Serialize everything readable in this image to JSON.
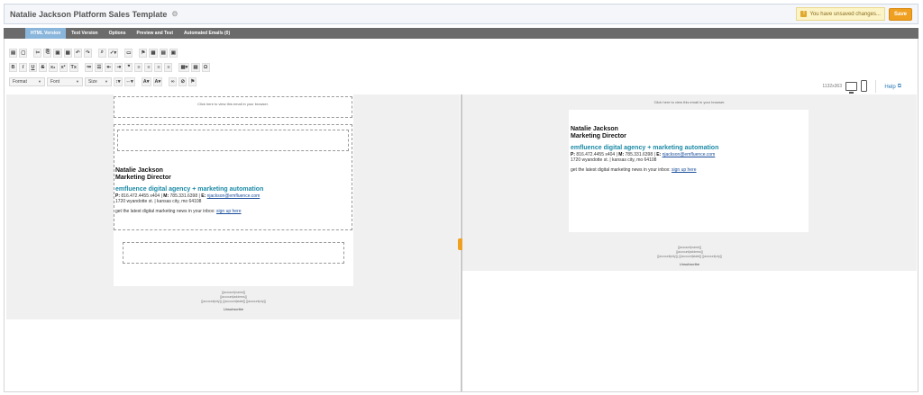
{
  "header": {
    "title": "Natalie Jackson Platform Sales Template",
    "unsaved_text": "You have unsaved changes...",
    "save_label": "Save"
  },
  "tabs": [
    {
      "label": "HTML Version",
      "active": true
    },
    {
      "label": "Text Version",
      "active": false
    },
    {
      "label": "Options",
      "active": false
    },
    {
      "label": "Preview and Test",
      "active": false
    },
    {
      "label": "Automated Emails (0)",
      "active": false
    }
  ],
  "toolbar": {
    "row1": [
      "source",
      "new-page",
      "cut",
      "copy",
      "paste",
      "paste-text",
      "undo",
      "redo",
      "find",
      "spellcheck",
      "image",
      "anchor",
      "table",
      "hr",
      "special"
    ],
    "row2": [
      "B",
      "I",
      "U",
      "S",
      "x₂",
      "x²",
      "Tx",
      "ol",
      "ul",
      "outdent",
      "indent",
      "quote",
      "left",
      "center",
      "right",
      "justify",
      "table2",
      "hr2",
      "Ω"
    ],
    "format_label": "Format",
    "font_label": "Font",
    "size_label": "Size"
  },
  "preview": {
    "resolution": "1132x363",
    "help_label": "Help"
  },
  "email": {
    "view_in_browser": "Click here to view this email in your browser.",
    "name": "Natalie Jackson",
    "role": "Marketing Director",
    "company": "emfluence digital agency + marketing automation",
    "phone_label": "P:",
    "phone": "816.472.4455 x404",
    "mobile_label": "M:",
    "mobile": "785.331.6398",
    "email_label": "E:",
    "email": "njackson@emfluence.com",
    "address": "1720 wyandotte st. | kansas city, mo 64108",
    "news_text": "get the latest digital marketing news in your inbox:",
    "signup_link": "sign up here",
    "footer_line1": "[[account|name]]",
    "footer_line2": "[[account|address]]",
    "footer_line3": "[[account|city]], [[account|state]] [[account|zip]]",
    "unsubscribe": "Unsubscribe"
  },
  "colors": {
    "accent": "#f0a020",
    "tab_active": "#8bb6dc",
    "company": "#1b8aa6"
  }
}
